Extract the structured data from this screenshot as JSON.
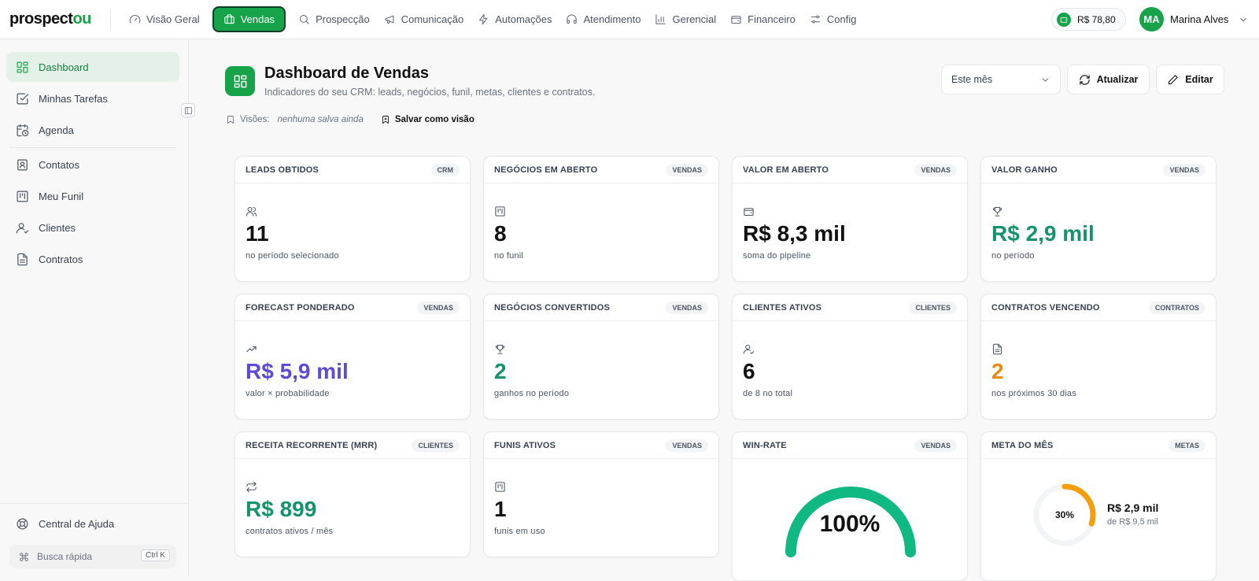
{
  "brand": {
    "part1": "prospect",
    "part2": "ou"
  },
  "nav": [
    {
      "label": "Visão Geral",
      "icon": "gauge-icon"
    },
    {
      "label": "Vendas",
      "icon": "briefcase-icon",
      "active": true
    },
    {
      "label": "Prospecção",
      "icon": "search-icon"
    },
    {
      "label": "Comunicação",
      "icon": "megaphone-icon"
    },
    {
      "label": "Automações",
      "icon": "zap-icon"
    },
    {
      "label": "Atendimento",
      "icon": "headphones-icon"
    },
    {
      "label": "Gerencial",
      "icon": "bar-chart-icon"
    },
    {
      "label": "Financeiro",
      "icon": "wallet-icon"
    },
    {
      "label": "Config",
      "icon": "sliders-icon"
    }
  ],
  "balance": "R$ 78,80",
  "user": {
    "initials": "MA",
    "name": "Marina Alves"
  },
  "sidebar": {
    "items": [
      {
        "label": "Dashboard",
        "icon": "dashboard-icon"
      },
      {
        "label": "Minhas Tarefas",
        "icon": "checkbox-icon"
      },
      {
        "label": "Agenda",
        "icon": "calendar-clock-icon"
      },
      {
        "label": "Contatos",
        "icon": "contacts-icon"
      },
      {
        "label": "Meu Funil",
        "icon": "kanban-icon"
      },
      {
        "label": "Clientes",
        "icon": "user-check-icon"
      },
      {
        "label": "Contratos",
        "icon": "file-text-icon"
      }
    ],
    "help": "Central de Ajuda",
    "quick_search": "Busca rápida",
    "shortcut": "Ctrl K"
  },
  "header": {
    "title": "Dashboard de Vendas",
    "subtitle": "Indicadores do seu CRM: leads, negócios, funil, metas, clientes e contratos.",
    "views_label": "Visões:",
    "views_none": "nenhuma salva ainda",
    "save_view": "Salvar como visão",
    "period": "Este mês",
    "refresh": "Atualizar",
    "edit": "Editar"
  },
  "cards": [
    {
      "title": "LEADS OBTIDOS",
      "tag": "CRM",
      "value": "11",
      "caption": "no período selecionado",
      "icon": "users-icon"
    },
    {
      "title": "NEGÓCIOS EM ABERTO",
      "tag": "VENDAS",
      "value": "8",
      "caption": "no funil",
      "icon": "kanban-icon"
    },
    {
      "title": "VALOR EM ABERTO",
      "tag": "VENDAS",
      "value": "R$ 8,3 mil",
      "caption": "soma do pipeline",
      "icon": "wallet-icon"
    },
    {
      "title": "VALOR GANHO",
      "tag": "VENDAS",
      "value": "R$ 2,9 mil",
      "caption": "no período",
      "icon": "trophy-icon"
    },
    {
      "title": "FORECAST PONDERADO",
      "tag": "VENDAS",
      "value": "R$ 5,9 mil",
      "caption": "valor × probabilidade",
      "icon": "trending-up-icon"
    },
    {
      "title": "NEGÓCIOS CONVERTIDOS",
      "tag": "VENDAS",
      "value": "2",
      "caption": "ganhos no período",
      "icon": "trophy-icon"
    },
    {
      "title": "CLIENTES ATIVOS",
      "tag": "CLIENTES",
      "value": "6",
      "caption": "de 8 no total",
      "icon": "user-check-icon"
    },
    {
      "title": "CONTRATOS VENCENDO",
      "tag": "CONTRATOS",
      "value": "2",
      "caption": "nos próximos 30 dias",
      "icon": "file-text-icon"
    },
    {
      "title": "RECEITA RECORRENTE (MRR)",
      "tag": "CLIENTES",
      "value": "R$ 899",
      "caption": "contratos ativos / mês",
      "icon": "repeat-icon"
    },
    {
      "title": "FUNIS ATIVOS",
      "tag": "VENDAS",
      "value": "1",
      "caption": "funis em uso",
      "icon": "kanban-icon"
    },
    {
      "title": "WIN-RATE",
      "tag": "VENDAS",
      "gauge_value": "100%",
      "gauge_fraction": 1.0
    },
    {
      "title": "META DO MÊS",
      "tag": "METAS",
      "ring_label": "30%",
      "ring_fraction": 0.3,
      "goal_value": "R$ 2,9 mil",
      "goal_of": "de R$ 9,5 mil"
    }
  ],
  "colors": {
    "brand": "#16a34a",
    "positive": "#15936a",
    "forecast": "#5b4bd6",
    "warning": "#ea8a0c",
    "gauge": "#10b981",
    "ring": "#f59e0b"
  }
}
